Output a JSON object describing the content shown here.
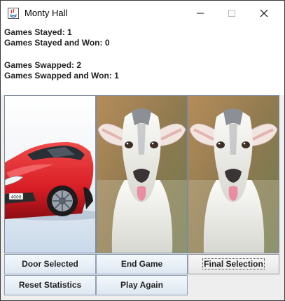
{
  "window": {
    "title": "Monty Hall"
  },
  "stats": {
    "games_stayed": "Games Stayed: 1",
    "games_stayed_won": "Games Stayed and Won: 0",
    "games_swapped": "Games Swapped: 2",
    "games_swapped_won": "Games Swapped and Won: 1"
  },
  "doors": [
    {
      "content": "car-image"
    },
    {
      "content": "goat-image"
    },
    {
      "content": "goat-image"
    }
  ],
  "buttons": {
    "door_selected": "Door Selected",
    "end_game": "End Game",
    "final_selection": "Final Selection",
    "reset_statistics": "Reset Statistics",
    "play_again": "Play Again"
  },
  "car_plate": "4000"
}
